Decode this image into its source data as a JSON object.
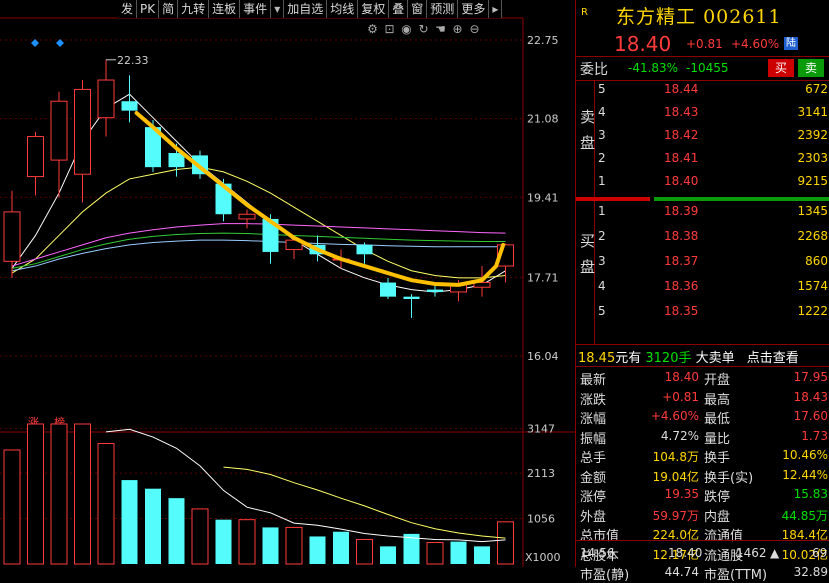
{
  "toolbar": [
    {
      "name": "tab-fa",
      "label": "发"
    },
    {
      "name": "tab-pk",
      "label": "PK"
    },
    {
      "name": "tab-jian",
      "label": "简"
    },
    {
      "name": "tab-jiuzhuan",
      "label": "九转"
    },
    {
      "name": "tab-lianban",
      "label": "连板"
    },
    {
      "name": "tab-shijian",
      "label": "事件"
    },
    {
      "name": "tab-dropdown",
      "label": "▾"
    },
    {
      "name": "tab-add-watch",
      "label": "加自选"
    },
    {
      "name": "tab-junxian",
      "label": "均线"
    },
    {
      "name": "tab-fuquan",
      "label": "复权"
    },
    {
      "name": "tab-die",
      "label": "叠"
    },
    {
      "name": "tab-chuang",
      "label": "窗"
    },
    {
      "name": "tab-yuce",
      "label": "预测"
    },
    {
      "name": "tab-more",
      "label": "更多"
    },
    {
      "name": "tab-more-arrow",
      "label": "▸"
    }
  ],
  "tool_icons": [
    "gear-icon",
    "lock-icon",
    "eye-icon",
    "refresh-icon",
    "hand-icon",
    "plus-icon",
    "minus-icon"
  ],
  "chart_data": [
    {
      "type": "candlestick",
      "title": "",
      "y_ticks": [
        "22.75",
        "21.08",
        "19.41",
        "17.71",
        "16.04"
      ],
      "ylim": [
        16.04,
        22.75
      ],
      "max_label": "22.33",
      "badge_labels": [
        "涨",
        "榜"
      ],
      "candles": [
        {
          "o": 18.05,
          "h": 19.55,
          "l": 17.7,
          "c": 19.1
        },
        {
          "o": 19.85,
          "h": 20.8,
          "l": 19.45,
          "c": 20.7
        },
        {
          "o": 20.2,
          "h": 21.65,
          "l": 19.4,
          "c": 21.45
        },
        {
          "o": 19.9,
          "h": 21.9,
          "l": 19.3,
          "c": 21.7
        },
        {
          "o": 21.1,
          "h": 22.33,
          "l": 20.7,
          "c": 21.9
        },
        {
          "o": 21.45,
          "h": 22.0,
          "l": 21.0,
          "c": 21.25
        },
        {
          "o": 20.9,
          "h": 21.05,
          "l": 19.95,
          "c": 20.05
        },
        {
          "o": 20.35,
          "h": 20.55,
          "l": 19.85,
          "c": 20.05
        },
        {
          "o": 20.3,
          "h": 20.4,
          "l": 19.8,
          "c": 19.9
        },
        {
          "o": 19.7,
          "h": 19.8,
          "l": 18.9,
          "c": 19.05
        },
        {
          "o": 18.95,
          "h": 19.15,
          "l": 18.75,
          "c": 19.05
        },
        {
          "o": 18.95,
          "h": 19.05,
          "l": 18.0,
          "c": 18.25
        },
        {
          "o": 18.3,
          "h": 18.6,
          "l": 18.1,
          "c": 18.5
        },
        {
          "o": 18.4,
          "h": 18.6,
          "l": 18.05,
          "c": 18.2
        },
        {
          "o": 18.1,
          "h": 18.3,
          "l": 17.9,
          "c": 18.1
        },
        {
          "o": 18.4,
          "h": 18.45,
          "l": 18.0,
          "c": 18.2
        },
        {
          "o": 17.6,
          "h": 17.7,
          "l": 17.25,
          "c": 17.3
        },
        {
          "o": 17.3,
          "h": 17.35,
          "l": 16.85,
          "c": 17.25
        },
        {
          "o": 17.45,
          "h": 17.55,
          "l": 17.3,
          "c": 17.4
        },
        {
          "o": 17.4,
          "h": 17.65,
          "l": 17.2,
          "c": 17.55
        },
        {
          "o": 17.5,
          "h": 17.95,
          "l": 17.3,
          "c": 17.6
        },
        {
          "o": 17.95,
          "h": 18.43,
          "l": 17.6,
          "c": 18.4
        }
      ],
      "ma_lines": [
        {
          "color": "#ffffff",
          "values": [
            17.9,
            18.6,
            19.5,
            20.6,
            21.3,
            21.6,
            21.1,
            20.6,
            20.1,
            19.7,
            19.3,
            18.9,
            18.5,
            18.2,
            17.9,
            17.7,
            17.55,
            17.45,
            17.4,
            17.45,
            17.55,
            17.85
          ]
        },
        {
          "color": "#ffff66",
          "values": [
            17.8,
            18.1,
            18.6,
            19.1,
            19.5,
            19.8,
            19.9,
            20.0,
            20.05,
            19.95,
            19.75,
            19.5,
            19.2,
            18.9,
            18.6,
            18.3,
            18.05,
            17.85,
            17.75,
            17.7,
            17.7,
            17.75
          ]
        },
        {
          "color": "#ff66ff",
          "values": [
            17.95,
            18.1,
            18.25,
            18.4,
            18.55,
            18.65,
            18.72,
            18.78,
            18.82,
            18.85,
            18.85,
            18.84,
            18.82,
            18.8,
            18.78,
            18.76,
            18.74,
            18.72,
            18.7,
            18.68,
            18.66,
            18.65
          ]
        },
        {
          "color": "#33cc33",
          "values": [
            17.9,
            18.0,
            18.15,
            18.3,
            18.42,
            18.52,
            18.58,
            18.62,
            18.64,
            18.65,
            18.64,
            18.62,
            18.6,
            18.58,
            18.56,
            18.54,
            18.52,
            18.5,
            18.49,
            18.48,
            18.47,
            18.47
          ]
        },
        {
          "color": "#99ccff",
          "values": [
            17.85,
            17.95,
            18.1,
            18.22,
            18.32,
            18.4,
            18.45,
            18.48,
            18.5,
            18.5,
            18.49,
            18.47,
            18.45,
            18.43,
            18.41,
            18.4,
            18.38,
            18.37,
            18.36,
            18.36,
            18.36,
            18.36
          ]
        }
      ],
      "highlight_curve": {
        "color": "#ffc000",
        "points": [
          [
            5.3,
            21.2
          ],
          [
            6,
            20.9
          ],
          [
            7,
            20.45
          ],
          [
            8,
            20.05
          ],
          [
            9,
            19.65
          ],
          [
            10,
            19.25
          ],
          [
            11,
            18.9
          ],
          [
            12,
            18.55
          ],
          [
            13,
            18.3
          ],
          [
            14,
            18.1
          ],
          [
            15,
            17.95
          ],
          [
            16,
            17.8
          ],
          [
            17,
            17.65
          ],
          [
            18,
            17.57
          ],
          [
            19,
            17.55
          ],
          [
            20,
            17.65
          ],
          [
            20.6,
            17.95
          ],
          [
            20.9,
            18.4
          ]
        ]
      }
    },
    {
      "type": "bar",
      "title": "",
      "y_ticks": [
        "3147",
        "2113",
        "1056"
      ],
      "unit": "X1000",
      "ylim": [
        0,
        3300
      ],
      "values": [
        2650,
        3300,
        3300,
        3300,
        2800,
        1950,
        1750,
        1530,
        1280,
        1030,
        1030,
        850,
        850,
        640,
        750,
        570,
        410,
        700,
        500,
        520,
        410,
        980
      ],
      "colors": [
        "red",
        "red",
        "red",
        "red",
        "red",
        "cyan",
        "cyan",
        "cyan",
        "red",
        "cyan",
        "red",
        "cyan",
        "red",
        "cyan",
        "cyan",
        "red",
        "cyan",
        "cyan",
        "red",
        "cyan",
        "cyan",
        "red"
      ],
      "ma_lines": [
        {
          "color": "#ffffff",
          "values": [
            null,
            null,
            null,
            null,
            3070,
            3130,
            2950,
            2690,
            2280,
            1710,
            1320,
            1190,
            950,
            900,
            810,
            710,
            650,
            610,
            570,
            560,
            520,
            560
          ]
        },
        {
          "color": "#ffff66",
          "values": [
            null,
            null,
            null,
            null,
            null,
            null,
            null,
            null,
            null,
            2250,
            2200,
            2080,
            1890,
            1720,
            1530,
            1350,
            1150,
            960,
            820,
            720,
            650,
            600
          ]
        }
      ]
    }
  ],
  "quote": {
    "r_label": "R",
    "name": "东方精工",
    "code": "002611",
    "price": "18.40",
    "change": "+0.81",
    "change_pct": "+4.60%",
    "market_badge": "陆",
    "weibi_label": "委比",
    "weibi_pct": "-41.83%",
    "weibi_diff": "-10455",
    "buy_button": "买",
    "sell_button": "卖",
    "sell_label": "卖盘",
    "buy_label": "买盘",
    "asks": [
      {
        "lvl": "5",
        "price": "18.44",
        "vol": "672"
      },
      {
        "lvl": "4",
        "price": "18.43",
        "vol": "3141"
      },
      {
        "lvl": "3",
        "price": "18.42",
        "vol": "2392"
      },
      {
        "lvl": "2",
        "price": "18.41",
        "vol": "2303"
      },
      {
        "lvl": "1",
        "price": "18.40",
        "vol": "9215"
      }
    ],
    "bids": [
      {
        "lvl": "1",
        "price": "18.39",
        "vol": "1345"
      },
      {
        "lvl": "2",
        "price": "18.38",
        "vol": "2268"
      },
      {
        "lvl": "3",
        "price": "18.37",
        "vol": "860"
      },
      {
        "lvl": "4",
        "price": "18.36",
        "vol": "1574"
      },
      {
        "lvl": "5",
        "price": "18.35",
        "vol": "1222"
      }
    ],
    "big_order": {
      "price": "18.45",
      "unit": "元有",
      "qty": "3120手",
      "type": "大卖单",
      "link": "点击查看"
    },
    "stats": [
      {
        "k1": "最新",
        "v1": "18.40",
        "c1": "red",
        "k2": "开盘",
        "v2": "17.95",
        "c2": "red"
      },
      {
        "k1": "涨跌",
        "v1": "+0.81",
        "c1": "red",
        "k2": "最高",
        "v2": "18.43",
        "c2": "red"
      },
      {
        "k1": "涨幅",
        "v1": "+4.60%",
        "c1": "red",
        "k2": "最低",
        "v2": "17.60",
        "c2": "red"
      },
      {
        "k1": "振幅",
        "v1": "4.72%",
        "c1": "white",
        "k2": "量比",
        "v2": "1.73",
        "c2": "red"
      },
      {
        "k1": "总手",
        "v1": "104.8万",
        "c1": "yellow",
        "k2": "换手",
        "v2": "10.46%",
        "c2": "yellow"
      },
      {
        "k1": "金额",
        "v1": "19.04亿",
        "c1": "yellow",
        "k2": "换手(实)",
        "v2": "12.44%",
        "c2": "yellow"
      },
      {
        "k1": "涨停",
        "v1": "19.35",
        "c1": "red",
        "k2": "跌停",
        "v2": "15.83",
        "c2": "green"
      },
      {
        "k1": "外盘",
        "v1": "59.97万",
        "c1": "red",
        "k2": "内盘",
        "v2": "44.85万",
        "c2": "green"
      },
      {
        "k1": "总市值",
        "v1": "224.0亿",
        "c1": "yellow",
        "k2": "流通值",
        "v2": "184.4亿",
        "c2": "yellow"
      },
      {
        "k1": "总股本",
        "v1": "12.17亿",
        "c1": "yellow",
        "k2": "流通股",
        "v2": "10.02亿",
        "c2": "yellow"
      },
      {
        "k1": "市盈(静)",
        "v1": "44.74",
        "c1": "white",
        "k2": "市盈(TTM)",
        "v2": "32.89",
        "c2": "white"
      }
    ],
    "tick": {
      "time": "14:56",
      "price": "18.40",
      "vol": "1462",
      "arrow": "▲",
      "count": "69"
    }
  }
}
